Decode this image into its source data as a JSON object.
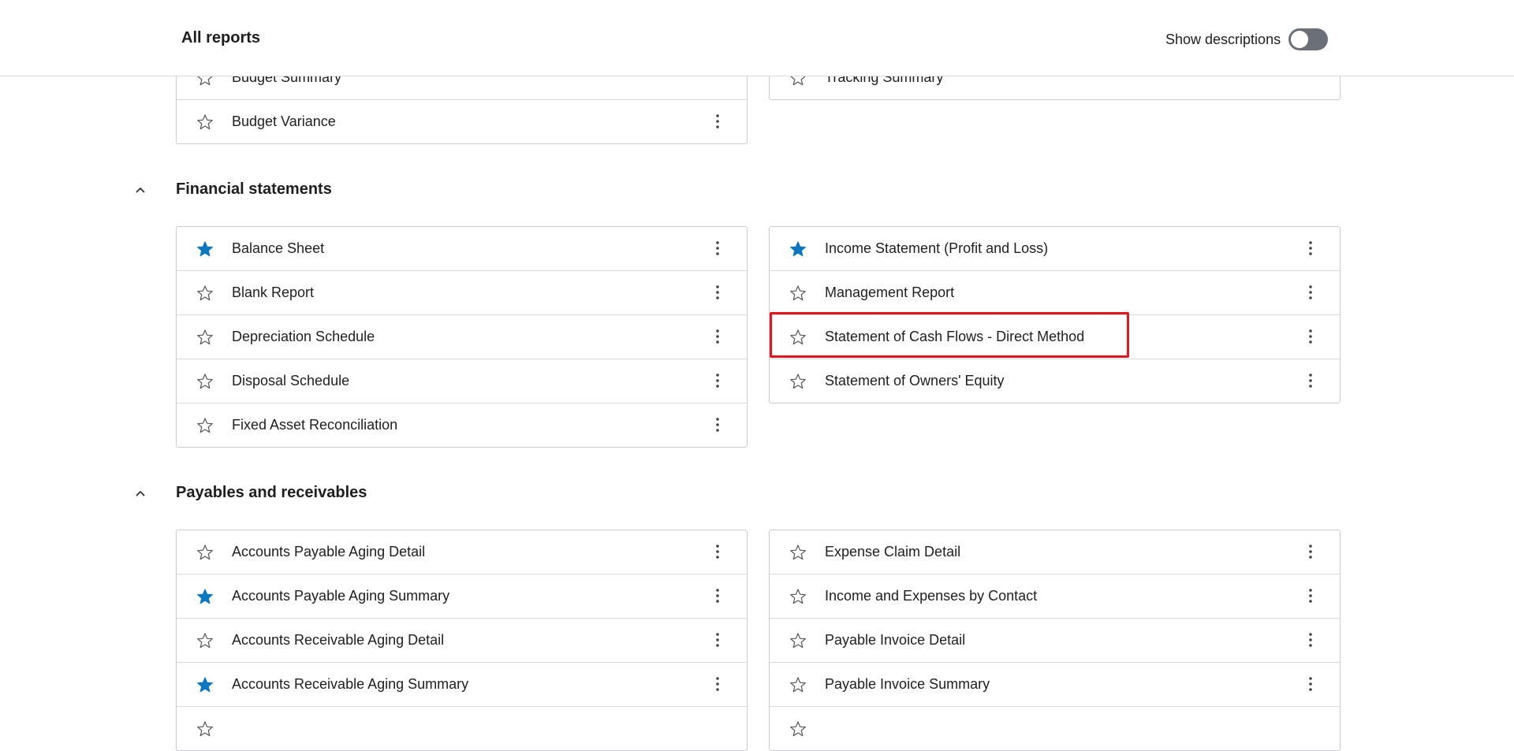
{
  "header": {
    "title": "All reports",
    "show_descriptions_label": "Show descriptions",
    "show_descriptions_on": false
  },
  "colors": {
    "star_active": "#0b78c1",
    "highlight": "#e3161e",
    "toggle_off": "#6b7078"
  },
  "top_partial": {
    "left": [
      {
        "label": "Budget Summary",
        "starred": false
      },
      {
        "label": "Budget Variance",
        "starred": false
      }
    ],
    "right": [
      {
        "label": "Tracking Summary",
        "starred": false
      }
    ]
  },
  "sections": [
    {
      "title": "Financial statements",
      "expanded": true,
      "left": [
        {
          "label": "Balance Sheet",
          "starred": true
        },
        {
          "label": "Blank Report",
          "starred": false
        },
        {
          "label": "Depreciation Schedule",
          "starred": false
        },
        {
          "label": "Disposal Schedule",
          "starred": false
        },
        {
          "label": "Fixed Asset Reconciliation",
          "starred": false
        }
      ],
      "right": [
        {
          "label": "Income Statement (Profit and Loss)",
          "starred": true
        },
        {
          "label": "Management Report",
          "starred": false
        },
        {
          "label": "Statement of Cash Flows - Direct Method",
          "starred": false,
          "highlighted": true
        },
        {
          "label": "Statement of Owners' Equity",
          "starred": false
        }
      ]
    },
    {
      "title": "Payables and receivables",
      "expanded": true,
      "left": [
        {
          "label": "Accounts Payable Aging Detail",
          "starred": false
        },
        {
          "label": "Accounts Payable Aging Summary",
          "starred": true
        },
        {
          "label": "Accounts Receivable Aging Detail",
          "starred": false
        },
        {
          "label": "Accounts Receivable Aging Summary",
          "starred": true
        },
        {
          "label": "",
          "starred": false
        }
      ],
      "right": [
        {
          "label": "Expense Claim Detail",
          "starred": false
        },
        {
          "label": "Income and Expenses by Contact",
          "starred": false
        },
        {
          "label": "Payable Invoice Detail",
          "starred": false
        },
        {
          "label": "Payable Invoice Summary",
          "starred": false
        },
        {
          "label": "",
          "starred": false
        }
      ]
    }
  ]
}
